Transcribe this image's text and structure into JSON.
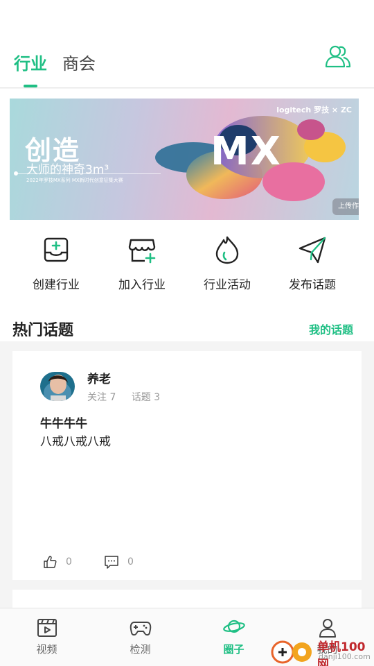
{
  "header": {
    "tabs": [
      {
        "label": "行业",
        "active": true
      },
      {
        "label": "商会",
        "active": false
      }
    ],
    "accent_color": "#1fbf84"
  },
  "banner": {
    "logo": "logitech 罗技 × ZC",
    "title": "创造",
    "subtitle": "大师的神奇3m³",
    "caption": "2022年罗技MX系列 MX新时代创意征集大赛",
    "product": "MX",
    "upload_label": "上传作"
  },
  "actions": [
    {
      "label": "创建行业",
      "icon": "create-industry-icon"
    },
    {
      "label": "加入行业",
      "icon": "join-industry-icon"
    },
    {
      "label": "行业活动",
      "icon": "flame-icon"
    },
    {
      "label": "发布话题",
      "icon": "send-icon"
    }
  ],
  "hot_topics": {
    "title": "热门话题",
    "my_topics_link": "我的话题"
  },
  "post": {
    "author": "养老",
    "follow_label": "关注 7",
    "topic_label": "话题 3",
    "title": "牛牛牛牛",
    "body": "八戒八戒八戒",
    "likes": "0",
    "comments": "0"
  },
  "tabbar": [
    {
      "label": "视频",
      "icon": "video-icon",
      "active": false
    },
    {
      "label": "检测",
      "icon": "gamepad-icon",
      "active": false
    },
    {
      "label": "圈子",
      "icon": "planet-icon",
      "active": true
    },
    {
      "label": "我的",
      "icon": "user-icon",
      "active": false
    }
  ],
  "watermark": {
    "text": "单机100网",
    "url": "danji100.com"
  }
}
